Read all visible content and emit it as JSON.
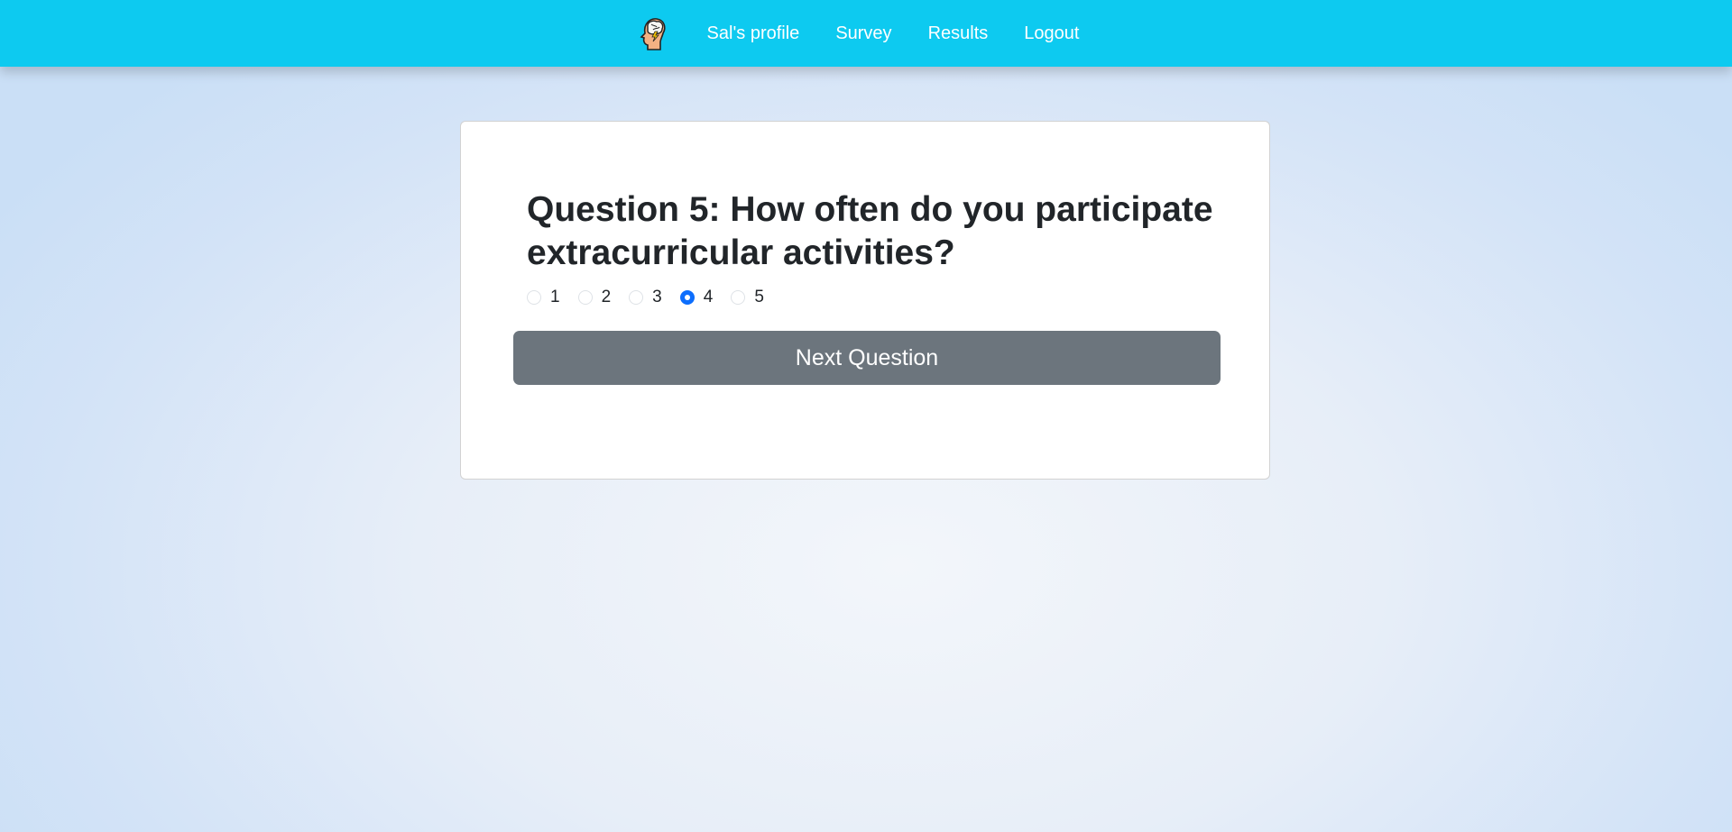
{
  "nav": {
    "logo_icon": "brain-head-icon",
    "links": [
      {
        "label": "Sal's profile"
      },
      {
        "label": "Survey"
      },
      {
        "label": "Results"
      },
      {
        "label": "Logout"
      }
    ]
  },
  "survey": {
    "question": "Question 5: How often do you participate extracurricular activities?",
    "options": [
      "1",
      "2",
      "3",
      "4",
      "5"
    ],
    "selected": "4",
    "next_label": "Next Question"
  },
  "colors": {
    "navbar": "#0dcaf0",
    "button": "#6c757d",
    "radio_checked": "#0d6efd"
  }
}
